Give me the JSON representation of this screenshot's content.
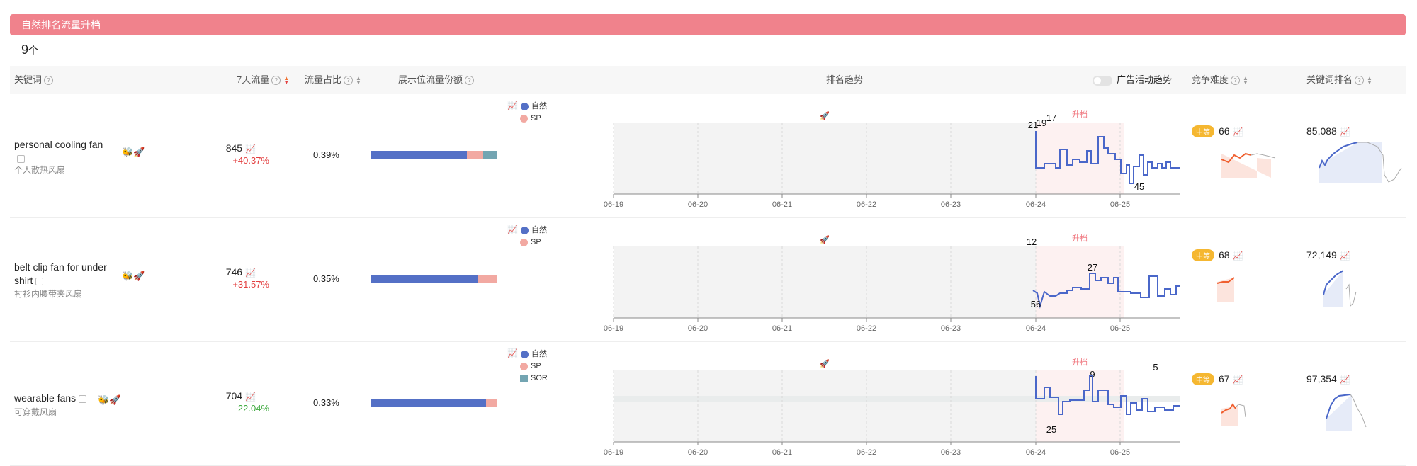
{
  "banner": {
    "title": "自然排名流量升档"
  },
  "count": {
    "value": "9",
    "unit": "个"
  },
  "header": {
    "keyword": "关键词",
    "traffic_7d": "7天流量",
    "traffic_share": "流量占比",
    "placement_share": "展示位流量份额",
    "rank_trend": "排名趋势",
    "ad_trend": "广告活动趋势",
    "difficulty": "竞争难度",
    "keyword_rank": "关键词排名"
  },
  "colors": {
    "natural": "#5470c6",
    "sp": "#f2a9a2",
    "sor": "#73a5b2",
    "accent": "#f0828c"
  },
  "chart_data": {
    "type": "line",
    "x_ticks": [
      "06-19",
      "06-20",
      "06-21",
      "06-22",
      "06-23",
      "06-24",
      "06-25"
    ],
    "annotation": "升档",
    "legend_labels": {
      "natural": "自然",
      "sp": "SP",
      "sor": "SOR"
    },
    "rows": [
      {
        "keyword": "personal cooling fan",
        "rank_labels": [
          "17",
          "21",
          "19",
          "45"
        ]
      },
      {
        "keyword": "belt clip fan for under shirt",
        "rank_labels": [
          "12",
          "27",
          "56"
        ]
      },
      {
        "keyword": "wearable fans",
        "rank_labels": [
          "5",
          "9",
          "25"
        ]
      }
    ]
  },
  "rows": [
    {
      "keyword": "personal cooling fan",
      "keyword_cn": "个人散热风扇",
      "traffic": "845",
      "change": "+40.37%",
      "share": "0.39%",
      "bar": {
        "natural": 0.76,
        "sp": 0.13,
        "sor": 0.11
      },
      "legend": [
        "自然",
        "SP"
      ],
      "difficulty_label": "中等",
      "difficulty": "66",
      "rank_value": "85,088",
      "labels": [
        {
          "t": "17"
        },
        {
          "t": "21"
        },
        {
          "t": "19"
        },
        {
          "t": "45"
        }
      ]
    },
    {
      "keyword": "belt clip fan for under shirt",
      "keyword_cn": "衬衫内腰带夹风扇",
      "traffic": "746",
      "change": "+31.57%",
      "share": "0.35%",
      "bar": {
        "natural": 0.85,
        "sp": 0.15,
        "sor": 0
      },
      "legend": [
        "自然",
        "SP"
      ],
      "difficulty_label": "中等",
      "difficulty": "68",
      "rank_value": "72,149",
      "labels": [
        {
          "t": "12"
        },
        {
          "t": "27"
        },
        {
          "t": "56"
        }
      ]
    },
    {
      "keyword": "wearable fans",
      "keyword_cn": "可穿戴风扇",
      "traffic": "704",
      "change": "-22.04%",
      "share": "0.33%",
      "bar": {
        "natural": 0.91,
        "sp": 0.09,
        "sor": 0
      },
      "legend": [
        "自然",
        "SP",
        "SOR"
      ],
      "difficulty_label": "中等",
      "difficulty": "67",
      "rank_value": "97,354",
      "labels": [
        {
          "t": "5"
        },
        {
          "t": "9"
        },
        {
          "t": "25"
        }
      ]
    }
  ]
}
